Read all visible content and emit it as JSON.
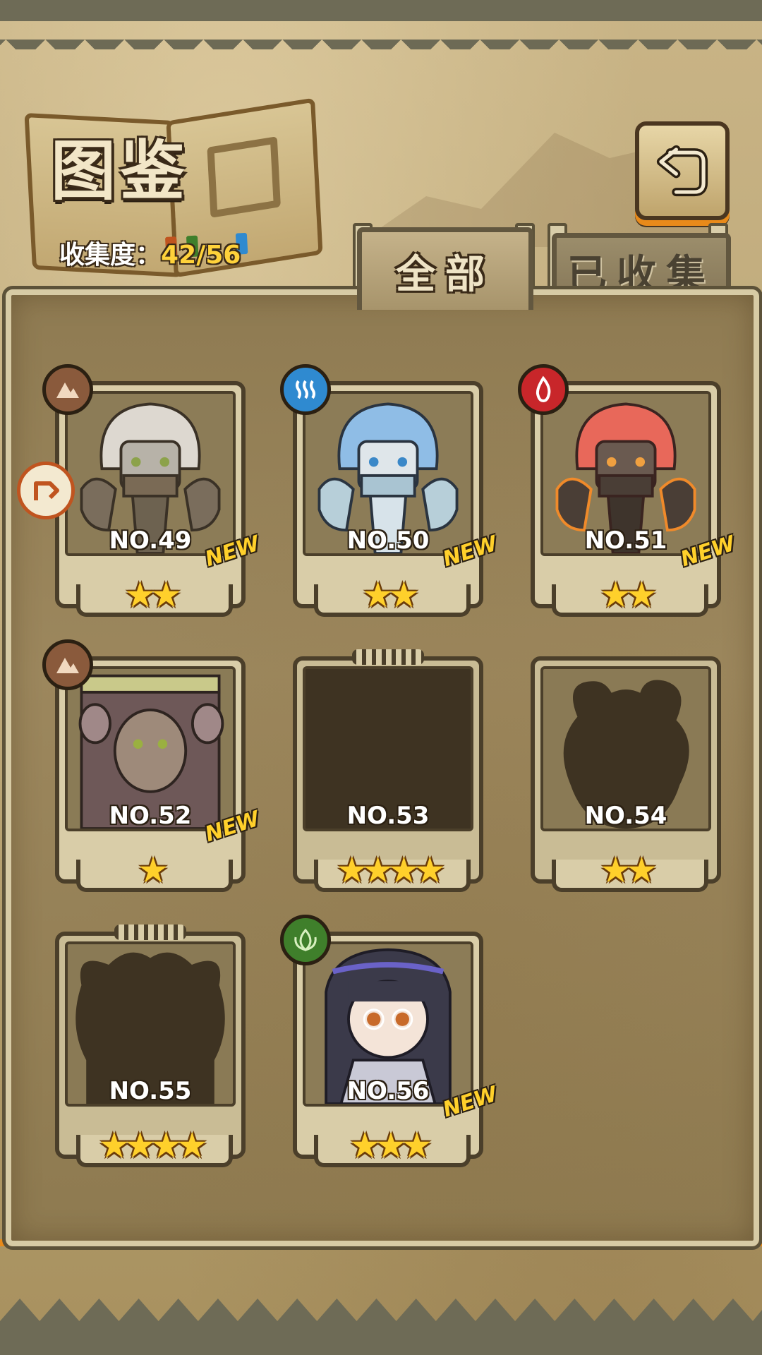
{
  "header": {
    "title": "图鉴",
    "collection_label": "收集度：",
    "collection_value": "42/56",
    "back_icon": "back-arrow-icon"
  },
  "tabs": [
    {
      "label": "全部",
      "active": true
    },
    {
      "label": "已收集",
      "active": false
    }
  ],
  "colors": {
    "accent_orange": "#e88a1a",
    "star": "#ffd02b",
    "water": "#2f8ad0",
    "fire": "#c8262a",
    "earth": "#8a5a3c",
    "leaf": "#3f7f2b"
  },
  "cards": [
    {
      "number": "NO.49",
      "stars": "★★",
      "new": "NEW",
      "element": "earth-icon",
      "locked": false
    },
    {
      "number": "NO.50",
      "stars": "★★",
      "new": "NEW",
      "element": "water-icon",
      "locked": false
    },
    {
      "number": "NO.51",
      "stars": "★★",
      "new": "NEW",
      "element": "fire-icon",
      "locked": false
    },
    {
      "number": "NO.52",
      "stars": "★",
      "new": "NEW",
      "element": "earth-icon",
      "locked": false
    },
    {
      "number": "NO.53",
      "stars": "★★★★",
      "new": "",
      "element": "",
      "locked": true
    },
    {
      "number": "NO.54",
      "stars": "★★",
      "new": "",
      "element": "",
      "locked": true
    },
    {
      "number": "NO.55",
      "stars": "★★★★",
      "new": "",
      "element": "",
      "locked": true
    },
    {
      "number": "NO.56",
      "stars": "★★★",
      "new": "NEW",
      "element": "leaf-icon",
      "locked": false
    }
  ]
}
